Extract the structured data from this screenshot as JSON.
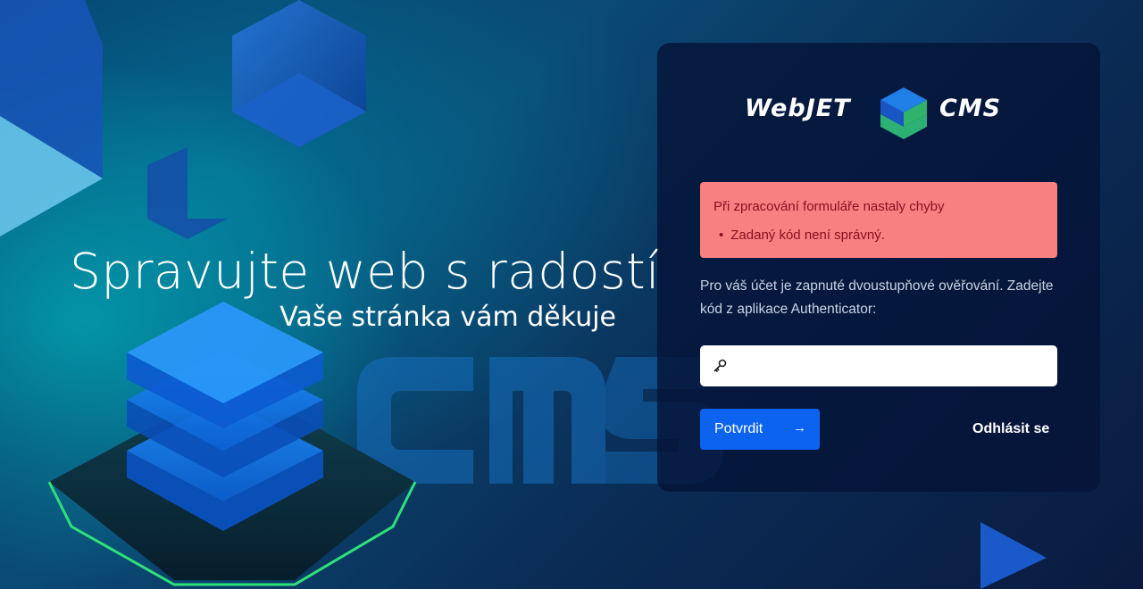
{
  "hero": {
    "title": "Spravujte web s radostí",
    "subtitle": "Vaše stránka vám děkuje"
  },
  "logo": {
    "left_text": "WebJET",
    "right_text": "CMS"
  },
  "alert": {
    "title": "Při zpracování formuláře nastaly chyby",
    "items": [
      "Zadaný kód není správný."
    ]
  },
  "form": {
    "info": "Pro váš účet je zapnuté dvoustupňové ověřování. Zadejte kód z aplikace Authenticator:",
    "code_value": "",
    "submit_label": "Potvrdit",
    "submit_icon": "arrow-right-icon",
    "logout_label": "Odhlásit se"
  },
  "colors": {
    "primary": "#0b63f0",
    "alert_bg": "#f88080",
    "alert_text": "#8a1020",
    "panel_bg": "#061438"
  }
}
